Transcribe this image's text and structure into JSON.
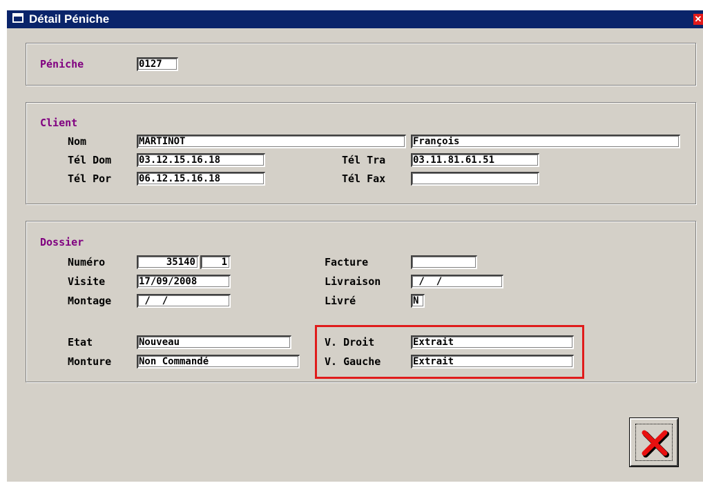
{
  "window": {
    "title": "Détail Péniche",
    "close_glyph": "✕"
  },
  "peniche": {
    "label": "Péniche",
    "value": "0127"
  },
  "client": {
    "section_label": "Client",
    "nom_label": "Nom",
    "nom_value": "MARTINOT",
    "prenom_value": "François",
    "tel_dom_label": "Tél Dom",
    "tel_dom_value": "03.12.15.16.18",
    "tel_tra_label": "Tél Tra",
    "tel_tra_value": "03.11.81.61.51",
    "tel_por_label": "Tél Por",
    "tel_por_value": "06.12.15.16.18",
    "tel_fax_label": "Tél Fax",
    "tel_fax_value": ""
  },
  "dossier": {
    "section_label": "Dossier",
    "numero_label": "Numéro",
    "numero_value": "35140",
    "numero_suffix": "1",
    "visite_label": "Visite",
    "visite_value": "17/09/2008",
    "montage_label": "Montage",
    "montage_value": " /  /",
    "facture_label": "Facture",
    "facture_value": "",
    "livraison_label": "Livraison",
    "livraison_value": " /  /",
    "livre_label": "Livré",
    "livre_value": "N",
    "etat_label": "Etat",
    "etat_value": "Nouveau",
    "monture_label": "Monture",
    "monture_value": "Non Commandé",
    "v_droit_label": "V. Droit",
    "v_droit_value": "Extrait",
    "v_gauche_label": "V. Gauche",
    "v_gauche_value": "Extrait"
  },
  "buttons": {
    "exit_icon": "red-x-icon"
  },
  "colors": {
    "title_bar": "#0a246a",
    "group_label": "#800080",
    "highlight": "#e01b1b",
    "exit_x": "#e81010"
  }
}
